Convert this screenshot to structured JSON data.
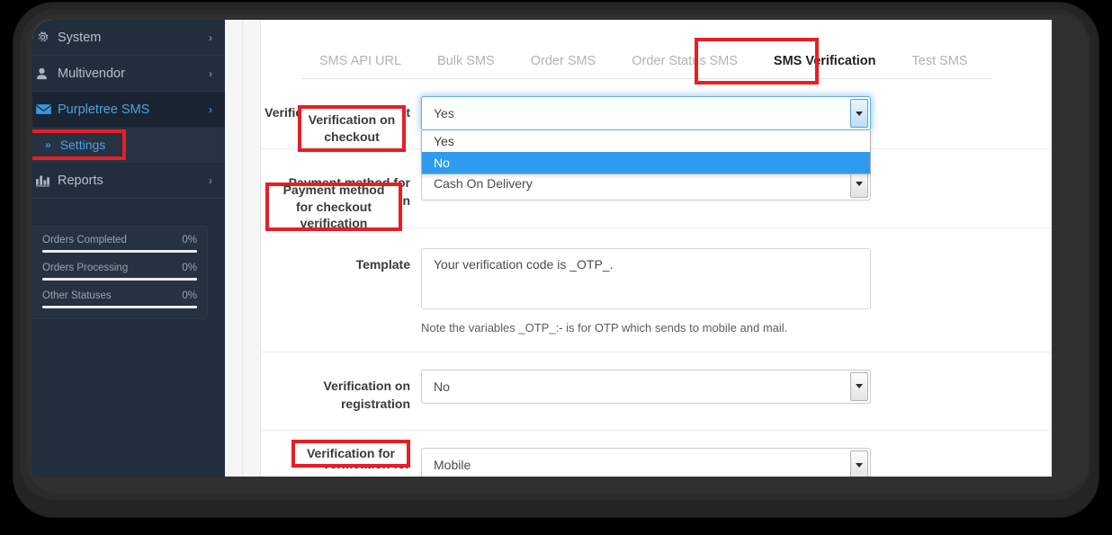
{
  "sidebar": {
    "items": [
      {
        "label": "System",
        "icon": "gear-icon",
        "caret": "›",
        "state": "normal"
      },
      {
        "label": "Multivendor",
        "icon": "user-icon",
        "caret": "›",
        "state": "normal"
      },
      {
        "label": "Purpletree SMS",
        "icon": "envelope-icon",
        "caret": "›",
        "state": "active"
      },
      {
        "label": "Reports",
        "icon": "bar-chart-icon",
        "caret": "›",
        "state": "normal"
      }
    ],
    "sub_item": {
      "label": "Settings",
      "chevron": "»"
    },
    "stats": [
      {
        "label": "Orders Completed",
        "value": "0%"
      },
      {
        "label": "Orders Processing",
        "value": "0%"
      },
      {
        "label": "Other Statuses",
        "value": "0%"
      }
    ]
  },
  "tabs": [
    {
      "label": "SMS API URL",
      "selected": false
    },
    {
      "label": "Bulk SMS",
      "selected": false
    },
    {
      "label": "Order SMS",
      "selected": false
    },
    {
      "label": "Order Status SMS",
      "selected": false
    },
    {
      "label": "SMS Verification",
      "selected": true
    },
    {
      "label": "Test SMS",
      "selected": false
    }
  ],
  "form": {
    "verification_on_checkout": {
      "label": "Verification on checkout",
      "value": "Yes",
      "options": [
        "Yes",
        "No"
      ],
      "highlighted_option": "No",
      "open": true,
      "focused": true
    },
    "payment_method": {
      "label": "Payment method for checkout verification",
      "value": "Cash On Delivery"
    },
    "template": {
      "label": "Template",
      "value": "Your verification code is _OTP_.",
      "help": "Note the variables _OTP_:- is for OTP which sends to mobile and mail."
    },
    "verification_on_registration": {
      "label": "Verification on registration",
      "value": "No"
    },
    "verification_for": {
      "label": "Verification for",
      "value": "Mobile"
    }
  },
  "annotations": {
    "color": "#ea1c24",
    "boxes": [
      "Settings",
      "Verification on checkout",
      "Payment method for checkout verification",
      "SMS Verification",
      "Verification for"
    ]
  }
}
